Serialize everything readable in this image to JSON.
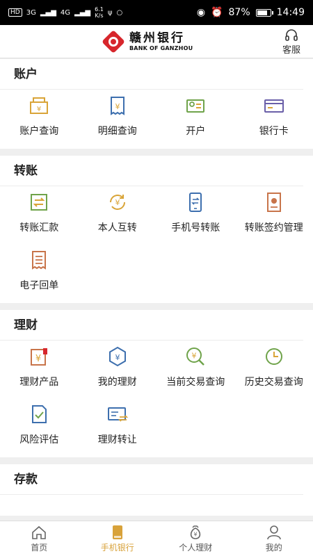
{
  "status_bar": {
    "hd_label": "HD",
    "network_1": "3G",
    "network_2": "4G",
    "speed_value": "6.1",
    "speed_unit": "K/s",
    "battery": "87%",
    "battery_level": 0.87,
    "time": "14:49"
  },
  "header": {
    "bank_name_cn": "赣州银行",
    "bank_name_en": "BANK OF GANZHOU",
    "service_label": "客服"
  },
  "sections": [
    {
      "title": "账户",
      "items": [
        {
          "label": "账户查询",
          "icon": "account-query-icon"
        },
        {
          "label": "明细查询",
          "icon": "detail-query-icon"
        },
        {
          "label": "开户",
          "icon": "open-account-icon"
        },
        {
          "label": "银行卡",
          "icon": "bank-card-icon"
        }
      ]
    },
    {
      "title": "转账",
      "items": [
        {
          "label": "转账汇款",
          "icon": "transfer-icon"
        },
        {
          "label": "本人互转",
          "icon": "self-transfer-icon"
        },
        {
          "label": "手机号转账",
          "icon": "phone-transfer-icon"
        },
        {
          "label": "转账签约管理",
          "icon": "transfer-contract-icon"
        },
        {
          "label": "电子回单",
          "icon": "e-receipt-icon"
        }
      ]
    },
    {
      "title": "理财",
      "items": [
        {
          "label": "理财产品",
          "icon": "wealth-product-icon"
        },
        {
          "label": "我的理财",
          "icon": "my-wealth-icon"
        },
        {
          "label": "当前交易查询",
          "icon": "current-trade-icon"
        },
        {
          "label": "历史交易查询",
          "icon": "history-trade-icon"
        },
        {
          "label": "风险评估",
          "icon": "risk-assessment-icon"
        },
        {
          "label": "理财转让",
          "icon": "wealth-transfer-icon"
        }
      ]
    },
    {
      "title": "存款",
      "items": []
    }
  ],
  "tabs": [
    {
      "label": "首页",
      "icon": "home-icon",
      "active": false
    },
    {
      "label": "手机银行",
      "icon": "mobile-bank-icon",
      "active": true
    },
    {
      "label": "个人理财",
      "icon": "personal-finance-icon",
      "active": false
    },
    {
      "label": "我的",
      "icon": "profile-icon",
      "active": false
    }
  ],
  "colors": {
    "accent": "#d8a23a",
    "brand_red": "#d7262c",
    "icon_gold": "#d9a437",
    "icon_green": "#6fa34a",
    "icon_blue": "#3d6fae",
    "icon_orange": "#c8744a",
    "icon_purple": "#6a5fa8"
  }
}
